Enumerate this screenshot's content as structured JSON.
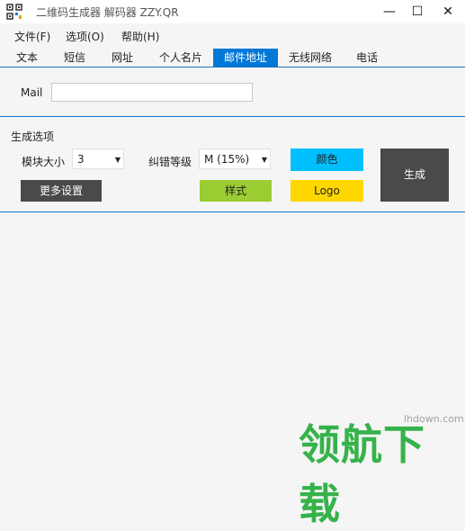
{
  "window": {
    "title": "二维码生成器 解码器 ZZY.QR",
    "minimize_glyph": "—",
    "maximize_glyph": "☐",
    "close_glyph": "✕"
  },
  "menu": {
    "items": [
      "文件(F)",
      "选项(O)",
      "帮助(H)"
    ]
  },
  "tabs": [
    "文本",
    "短信",
    "网址",
    "个人名片",
    "邮件地址",
    "无线网络",
    "电话"
  ],
  "active_tab": "邮件地址",
  "mail": {
    "label": "Mail",
    "value": ""
  },
  "options": {
    "title": "生成选项",
    "module_size_label": "模块大小",
    "module_size_value": "3",
    "ecc_label": "纠错等级",
    "ecc_value": "M (15%)",
    "color_button": "颜色",
    "style_button": "样式",
    "logo_button": "Logo",
    "more_settings_button": "更多设置",
    "generate_button": "生成"
  },
  "colors": {
    "accent": "#0078d7",
    "color_button_bg": "#00bfff",
    "style_button_bg": "#9acd32",
    "logo_button_bg": "#ffd700",
    "dark_button_bg": "#4a4a4a",
    "watermark": "#36b24a"
  },
  "watermark": {
    "site": "lhdown.com",
    "brand": "领航下载"
  }
}
